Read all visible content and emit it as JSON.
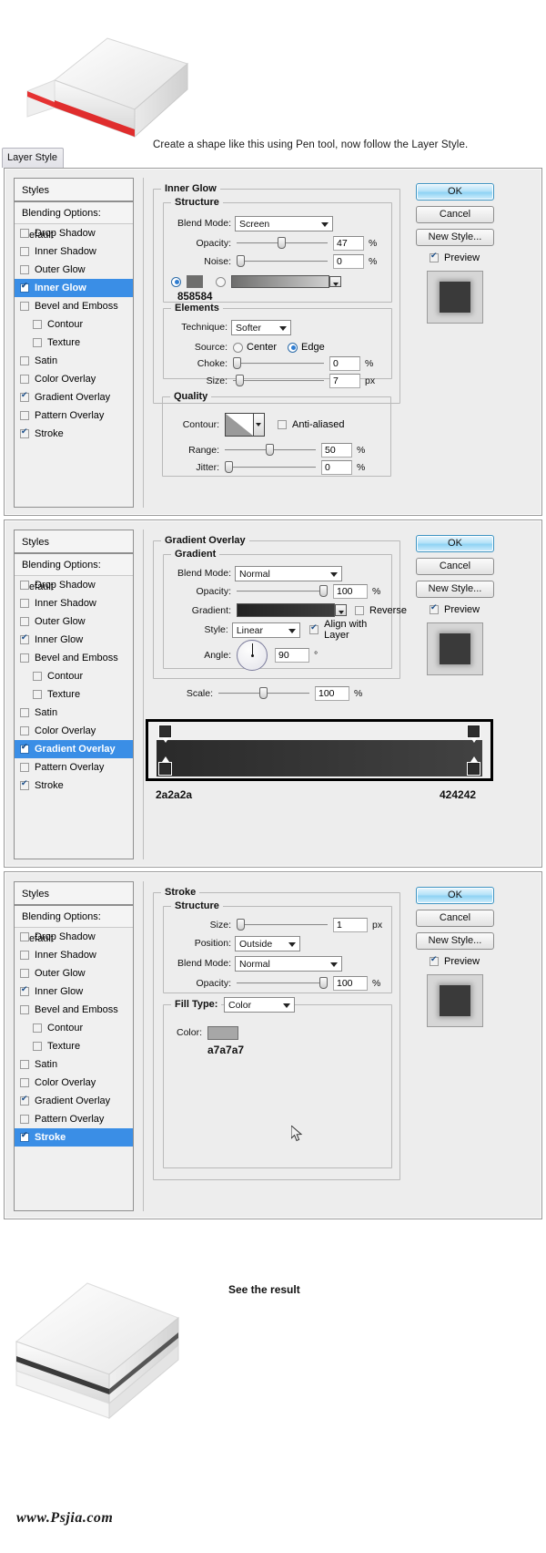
{
  "window": {
    "tab_label": "Layer Style"
  },
  "captions": {
    "top": "Create a shape like this using Pen tool, now follow the Layer Style.",
    "bottom": "See the result",
    "watermark": "www.Psjia.com"
  },
  "styles_list": {
    "header": "Styles",
    "blending_options": "Blending Options: Default",
    "items": [
      {
        "label": "Drop Shadow",
        "checked": false,
        "indent": false,
        "selected": false
      },
      {
        "label": "Inner Shadow",
        "checked": false,
        "indent": false,
        "selected": false
      },
      {
        "label": "Outer Glow",
        "checked": false,
        "indent": false,
        "selected": false
      },
      {
        "label": "Inner Glow",
        "checked": true,
        "indent": false,
        "selected": true
      },
      {
        "label": "Bevel and Emboss",
        "checked": false,
        "indent": false,
        "selected": false
      },
      {
        "label": "Contour",
        "checked": false,
        "indent": true,
        "selected": false
      },
      {
        "label": "Texture",
        "checked": false,
        "indent": true,
        "selected": false
      },
      {
        "label": "Satin",
        "checked": false,
        "indent": false,
        "selected": false
      },
      {
        "label": "Color Overlay",
        "checked": false,
        "indent": false,
        "selected": false
      },
      {
        "label": "Gradient Overlay",
        "checked": true,
        "indent": false,
        "selected": false
      },
      {
        "label": "Pattern Overlay",
        "checked": false,
        "indent": false,
        "selected": false
      },
      {
        "label": "Stroke",
        "checked": true,
        "indent": false,
        "selected": false
      }
    ]
  },
  "styles_list_2": {
    "header": "Styles",
    "blending_options": "Blending Options: Default",
    "items": [
      {
        "label": "Drop Shadow",
        "checked": false,
        "indent": false,
        "selected": false
      },
      {
        "label": "Inner Shadow",
        "checked": false,
        "indent": false,
        "selected": false
      },
      {
        "label": "Outer Glow",
        "checked": false,
        "indent": false,
        "selected": false
      },
      {
        "label": "Inner Glow",
        "checked": true,
        "indent": false,
        "selected": false
      },
      {
        "label": "Bevel and Emboss",
        "checked": false,
        "indent": false,
        "selected": false
      },
      {
        "label": "Contour",
        "checked": false,
        "indent": true,
        "selected": false
      },
      {
        "label": "Texture",
        "checked": false,
        "indent": true,
        "selected": false
      },
      {
        "label": "Satin",
        "checked": false,
        "indent": false,
        "selected": false
      },
      {
        "label": "Color Overlay",
        "checked": false,
        "indent": false,
        "selected": false
      },
      {
        "label": "Gradient Overlay",
        "checked": true,
        "indent": false,
        "selected": true
      },
      {
        "label": "Pattern Overlay",
        "checked": false,
        "indent": false,
        "selected": false
      },
      {
        "label": "Stroke",
        "checked": true,
        "indent": false,
        "selected": false
      }
    ]
  },
  "styles_list_3": {
    "header": "Styles",
    "blending_options": "Blending Options: Default",
    "items": [
      {
        "label": "Drop Shadow",
        "checked": false,
        "indent": false,
        "selected": false
      },
      {
        "label": "Inner Shadow",
        "checked": false,
        "indent": false,
        "selected": false
      },
      {
        "label": "Outer Glow",
        "checked": false,
        "indent": false,
        "selected": false
      },
      {
        "label": "Inner Glow",
        "checked": true,
        "indent": false,
        "selected": false
      },
      {
        "label": "Bevel and Emboss",
        "checked": false,
        "indent": false,
        "selected": false
      },
      {
        "label": "Contour",
        "checked": false,
        "indent": true,
        "selected": false
      },
      {
        "label": "Texture",
        "checked": false,
        "indent": true,
        "selected": false
      },
      {
        "label": "Satin",
        "checked": false,
        "indent": false,
        "selected": false
      },
      {
        "label": "Color Overlay",
        "checked": false,
        "indent": false,
        "selected": false
      },
      {
        "label": "Gradient Overlay",
        "checked": true,
        "indent": false,
        "selected": false
      },
      {
        "label": "Pattern Overlay",
        "checked": false,
        "indent": false,
        "selected": false
      },
      {
        "label": "Stroke",
        "checked": true,
        "indent": false,
        "selected": true
      }
    ]
  },
  "buttons": {
    "ok": "OK",
    "cancel": "Cancel",
    "new_style": "New Style...",
    "preview": "Preview"
  },
  "panel_inner_glow": {
    "title": "Inner Glow",
    "structure_title": "Structure",
    "blend_mode_label": "Blend Mode:",
    "blend_mode_value": "Screen",
    "opacity_label": "Opacity:",
    "opacity_value": "47",
    "opacity_unit": "%",
    "noise_label": "Noise:",
    "noise_value": "0",
    "noise_unit": "%",
    "color_hex": "858584",
    "color_swatch": "#6e6e6d",
    "elements_title": "Elements",
    "technique_label": "Technique:",
    "technique_value": "Softer",
    "source_label": "Source:",
    "source_center": "Center",
    "source_edge": "Edge",
    "source_selected": "Edge",
    "choke_label": "Choke:",
    "choke_value": "0",
    "choke_unit": "%",
    "size_label": "Size:",
    "size_value": "7",
    "size_unit": "px",
    "quality_title": "Quality",
    "contour_label": "Contour:",
    "anti_aliased_label": "Anti-aliased",
    "anti_aliased_checked": false,
    "range_label": "Range:",
    "range_value": "50",
    "range_unit": "%",
    "jitter_label": "Jitter:",
    "jitter_value": "0",
    "jitter_unit": "%"
  },
  "panel_gradient_overlay": {
    "title": "Gradient Overlay",
    "gradient_title": "Gradient",
    "blend_mode_label": "Blend Mode:",
    "blend_mode_value": "Normal",
    "opacity_label": "Opacity:",
    "opacity_value": "100",
    "opacity_unit": "%",
    "gradient_label": "Gradient:",
    "reverse_label": "Reverse",
    "reverse_checked": false,
    "style_label": "Style:",
    "style_value": "Linear",
    "align_label": "Align with Layer",
    "align_checked": true,
    "angle_label": "Angle:",
    "angle_value": "90",
    "angle_unit": "°",
    "scale_label": "Scale:",
    "scale_value": "100",
    "scale_unit": "%",
    "editor": {
      "stop_left_hex": "2a2a2a",
      "stop_right_hex": "424242",
      "stop_left_color": "#2a2a2a",
      "stop_right_color": "#424242"
    }
  },
  "panel_stroke": {
    "title": "Stroke",
    "structure_title": "Structure",
    "size_label": "Size:",
    "size_value": "1",
    "size_unit": "px",
    "position_label": "Position:",
    "position_value": "Outside",
    "blend_mode_label": "Blend Mode:",
    "blend_mode_value": "Normal",
    "opacity_label": "Opacity:",
    "opacity_value": "100",
    "opacity_unit": "%",
    "fill_type_label": "Fill Type:",
    "fill_type_value": "Color",
    "color_label": "Color:",
    "color_hex": "a7a7a7",
    "color_swatch": "#a7a7a7"
  }
}
